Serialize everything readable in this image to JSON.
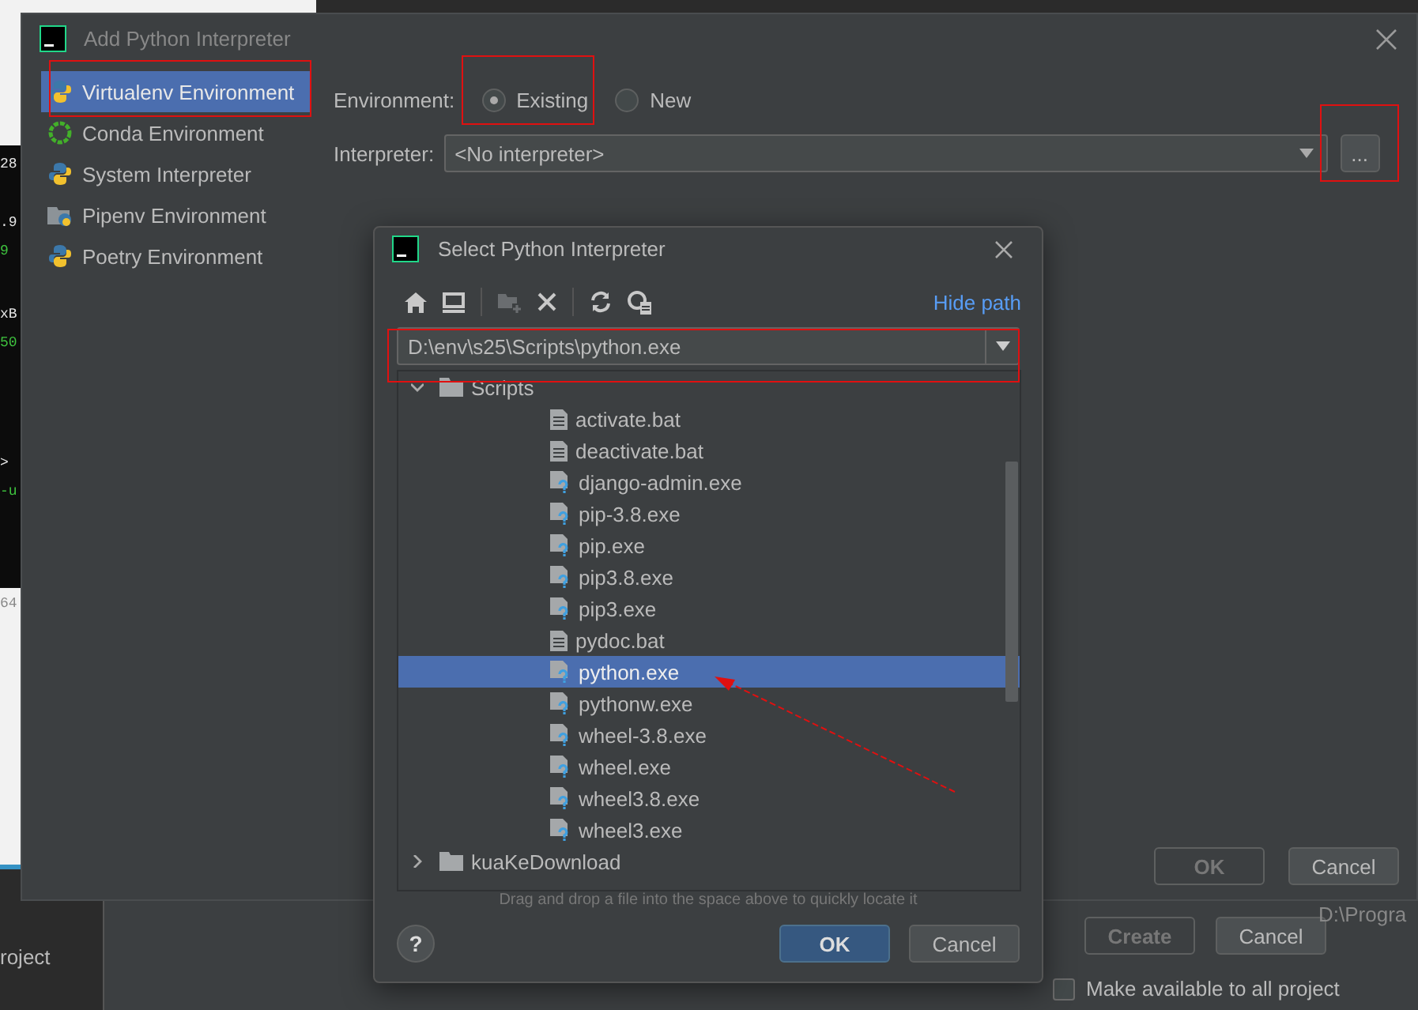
{
  "background": {
    "terminal_lines": [
      {
        "text": "28",
        "color": "#e6e6e6"
      },
      {
        "text": ".9",
        "color": "#e6e6e6"
      },
      {
        "text": "9",
        "color": "#3fc43f"
      },
      {
        "text": "xB",
        "color": "#e6e6e6"
      },
      {
        "text": "50",
        "color": "#3fc43f"
      },
      {
        "text": ">",
        "color": "#e6e6e6"
      },
      {
        "text": "-u",
        "color": "#3fc43f"
      }
    ],
    "gutter_text": "64",
    "project_label": "roject",
    "back_dialog": {
      "path_text": "D:\\Progra",
      "buttons": [
        {
          "label": "Create",
          "disabled": true
        },
        {
          "label": "Cancel",
          "disabled": false
        }
      ],
      "checkbox": {
        "label": "Make available to all project",
        "checked": false
      }
    }
  },
  "main_dialog": {
    "title": "Add Python Interpreter",
    "sidebar": [
      {
        "label": "Virtualenv Environment",
        "kind": "virtualenv",
        "selected": true
      },
      {
        "label": "Conda Environment",
        "kind": "conda",
        "selected": false
      },
      {
        "label": "System Interpreter",
        "kind": "python",
        "selected": false
      },
      {
        "label": "Pipenv Environment",
        "kind": "pipenv",
        "selected": false
      },
      {
        "label": "Poetry Environment",
        "kind": "poetry",
        "selected": false
      }
    ],
    "environment": {
      "label": "Environment:",
      "options": [
        {
          "label": "Existing",
          "selected": true
        },
        {
          "label": "New",
          "selected": false
        }
      ]
    },
    "interpreter": {
      "label": "Interpreter:",
      "value": "<No interpreter>"
    },
    "browse_button": "...",
    "buttons": [
      {
        "label": "OK",
        "disabled": true
      },
      {
        "label": "Cancel",
        "disabled": false
      }
    ]
  },
  "select_dialog": {
    "title": "Select Python Interpreter",
    "hide_path": "Hide path",
    "path": "D:\\env\\s25\\Scripts\\python.exe",
    "tree": [
      {
        "name": "Scripts",
        "kind": "folder",
        "expanded": true,
        "selected": false,
        "children": [
          {
            "name": "activate.bat",
            "kind": "script",
            "selected": false
          },
          {
            "name": "deactivate.bat",
            "kind": "script",
            "selected": false
          },
          {
            "name": "django-admin.exe",
            "kind": "executable",
            "selected": false
          },
          {
            "name": "pip-3.8.exe",
            "kind": "executable",
            "selected": false
          },
          {
            "name": "pip.exe",
            "kind": "executable",
            "selected": false
          },
          {
            "name": "pip3.8.exe",
            "kind": "executable",
            "selected": false
          },
          {
            "name": "pip3.exe",
            "kind": "executable",
            "selected": false
          },
          {
            "name": "pydoc.bat",
            "kind": "script",
            "selected": false
          },
          {
            "name": "python.exe",
            "kind": "executable",
            "selected": true
          },
          {
            "name": "pythonw.exe",
            "kind": "executable",
            "selected": false
          },
          {
            "name": "wheel-3.8.exe",
            "kind": "executable",
            "selected": false
          },
          {
            "name": "wheel.exe",
            "kind": "executable",
            "selected": false
          },
          {
            "name": "wheel3.8.exe",
            "kind": "executable",
            "selected": false
          },
          {
            "name": "wheel3.exe",
            "kind": "executable",
            "selected": false
          }
        ]
      },
      {
        "name": "kuaKeDownload",
        "kind": "folder",
        "expanded": false,
        "selected": false
      }
    ],
    "hint": "Drag and drop a file into the space above to quickly locate it",
    "help": "?",
    "buttons": [
      {
        "label": "OK",
        "primary": true
      },
      {
        "label": "Cancel",
        "primary": false
      }
    ]
  }
}
